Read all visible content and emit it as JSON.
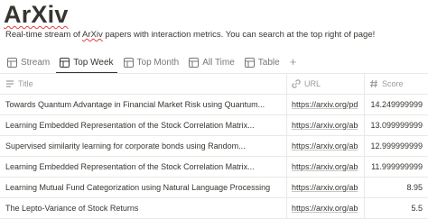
{
  "page": {
    "title": "ArXiv",
    "description_parts": [
      "Real-time stream of ",
      "ArXiv",
      " papers with interaction metrics. You can search at the top right of page!"
    ]
  },
  "tabs": [
    {
      "label": "Stream",
      "icon": "table-icon",
      "active": false
    },
    {
      "label": "Top Week",
      "icon": "table-icon",
      "active": true
    },
    {
      "label": "Top Month",
      "icon": "table-icon",
      "active": false
    },
    {
      "label": "All Time",
      "icon": "table-icon",
      "active": false
    },
    {
      "label": "Table",
      "icon": "table-icon",
      "active": false
    }
  ],
  "add_tab_symbol": "+",
  "table": {
    "columns": [
      {
        "label": "Title",
        "icon": "text-icon"
      },
      {
        "label": "URL",
        "icon": "link-icon"
      },
      {
        "label": "Score",
        "icon": "hash-icon"
      }
    ],
    "rows": [
      {
        "title": "Towards Quantum Advantage in Financial Market Risk using Quantum...",
        "url": "https://arxiv.org/pd",
        "score": "14.249999999"
      },
      {
        "title": "Learning Embedded Representation of the Stock Correlation Matrix...",
        "url": "https://arxiv.org/ab",
        "score": "13.099999999"
      },
      {
        "title": "Supervised similarity learning for corporate bonds using Random...",
        "url": "https://arxiv.org/ab",
        "score": "12.999999999"
      },
      {
        "title": "Learning Embedded Representation of the Stock Correlation Matrix...",
        "url": "https://arxiv.org/ab",
        "score": "11.999999999"
      },
      {
        "title": "Learning Mutual Fund Categorization using Natural Language Processing",
        "url": "https://arxiv.org/ab",
        "score": "8.95"
      },
      {
        "title": "The Lepto-Variance of Stock Returns",
        "url": "https://arxiv.org/ab",
        "score": "5.5"
      }
    ]
  },
  "colors": {
    "text": "#37352f",
    "muted": "#787774",
    "border": "#e9e9e7",
    "spellcheck": "#e03e3e"
  }
}
